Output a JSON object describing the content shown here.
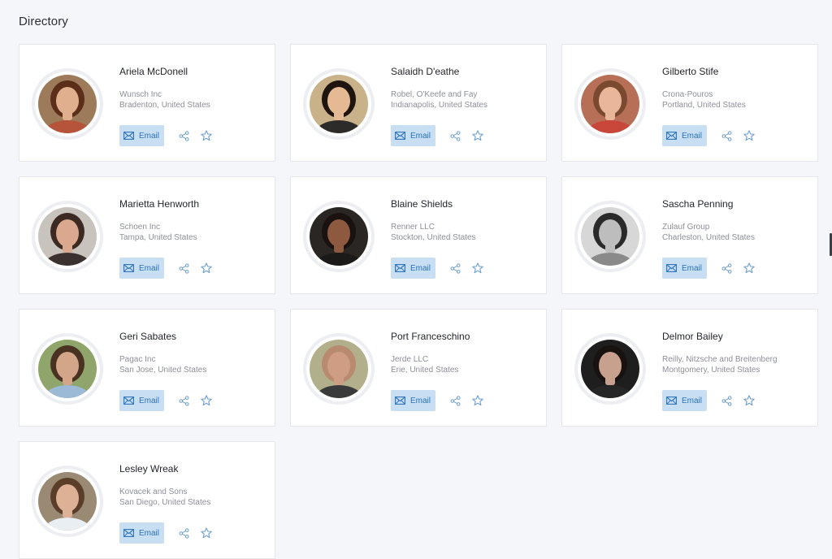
{
  "page": {
    "title": "Directory"
  },
  "labels": {
    "email": "Email"
  },
  "colors": {
    "accent": "#2d73b8",
    "email_bg": "#c7def3",
    "card_bg": "#ffffff",
    "page_bg": "#f5f6fa"
  },
  "icons": {
    "email": "envelope-icon",
    "share": "share-icon",
    "favorite": "star-outline-icon"
  },
  "contacts": [
    {
      "name": "Ariela McDonell",
      "company": "Wunsch Inc",
      "location": "Bradenton, United States",
      "photo": {
        "bg": "#9c7a5a",
        "hair": "#5a2e18",
        "skin": "#e0b08e",
        "shirt": "#b5533b"
      }
    },
    {
      "name": "Salaidh D'eathe",
      "company": "Robel, O'Keefe and Fay",
      "location": "Indianapolis, United States",
      "photo": {
        "bg": "#c9b28a",
        "hair": "#1e1410",
        "skin": "#e5b994",
        "shirt": "#2d2a2a"
      }
    },
    {
      "name": "Gilberto Stife",
      "company": "Crona-Pouros",
      "location": "Portland, United States",
      "photo": {
        "bg": "#b86f58",
        "hair": "#7a4a30",
        "skin": "#eab69a",
        "shirt": "#c9463b"
      }
    },
    {
      "name": "Marietta Henworth",
      "company": "Schoen Inc",
      "location": "Tampa, United States",
      "photo": {
        "bg": "#c9c3bd",
        "hair": "#3c2a22",
        "skin": "#d9a88f",
        "shirt": "#3a3230"
      }
    },
    {
      "name": "Blaine Shields",
      "company": "Renner LLC",
      "location": "Stockton, United States",
      "photo": {
        "bg": "#2a2624",
        "hair": "#1a1210",
        "skin": "#8d5a3f",
        "shirt": "#1c1a19"
      }
    },
    {
      "name": "Sascha Penning",
      "company": "Zulauf Group",
      "location": "Charleston, United States",
      "photo": {
        "bg": "#d7d7d7",
        "hair": "#2a2a2a",
        "skin": "#bdbdbd",
        "shirt": "#8a8a8a"
      }
    },
    {
      "name": "Geri Sabates",
      "company": "Pagac Inc",
      "location": "San Jose, United States",
      "photo": {
        "bg": "#8fa56c",
        "hair": "#4a3222",
        "skin": "#d3a68a",
        "shirt": "#9cb9d6"
      }
    },
    {
      "name": "Port Franceschino",
      "company": "Jerde LLC",
      "location": "Erie, United States",
      "photo": {
        "bg": "#b2b08c",
        "hair": "#b88b70",
        "skin": "#cf9d83",
        "shirt": "#3a3a3a"
      }
    },
    {
      "name": "Delmor Bailey",
      "company": "Reilly, Nitzsche and Breitenberg",
      "location": "Montgomery, United States",
      "photo": {
        "bg": "#1e1e1e",
        "hair": "#181210",
        "skin": "#c8a18e",
        "shirt": "#262626"
      }
    },
    {
      "name": "Lesley Wreak",
      "company": "Kovacek and Sons",
      "location": "San Diego, United States",
      "photo": {
        "bg": "#9a8a74",
        "hair": "#5a3e2a",
        "skin": "#ddb195",
        "shirt": "#e9eef3"
      }
    }
  ]
}
